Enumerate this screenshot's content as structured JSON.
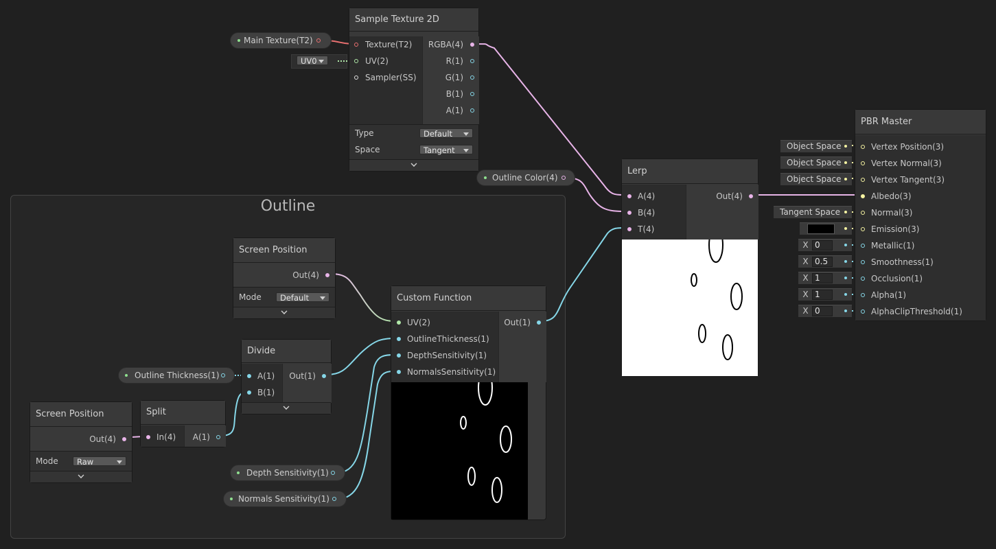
{
  "colors": {
    "bg": "#202020",
    "vec4_wire": "#e8b4e8",
    "vec1_wire": "#86d7e8",
    "vec2_wire": "#b0e8a8",
    "texture_wire": "#e87070",
    "vec3_wire": "#f6f4a2"
  },
  "group": {
    "title": "Outline"
  },
  "sample_texture": {
    "title": "Sample Texture 2D",
    "inputs": [
      "Texture(T2)",
      "UV(2)",
      "Sampler(SS)"
    ],
    "outputs": [
      "RGBA(4)",
      "R(1)",
      "G(1)",
      "B(1)",
      "A(1)"
    ],
    "type_label": "Type",
    "type_value": "Default",
    "space_label": "Space",
    "space_value": "Tangent",
    "uv_value": "UV0"
  },
  "main_texture_prop": {
    "label": "Main Texture(T2)"
  },
  "outline_color_prop": {
    "label": "Outline Color(4)"
  },
  "lerp": {
    "title": "Lerp",
    "inputs": [
      "A(4)",
      "B(4)",
      "T(4)"
    ],
    "output": "Out(4)"
  },
  "pbr_master": {
    "title": "PBR Master",
    "ports": [
      "Vertex Position(3)",
      "Vertex Normal(3)",
      "Vertex Tangent(3)",
      "Albedo(3)",
      "Normal(3)",
      "Emission(3)",
      "Metallic(1)",
      "Smoothness(1)",
      "Occlusion(1)",
      "Alpha(1)",
      "AlphaClipThreshold(1)"
    ],
    "slots": {
      "vertex_position": "Object Space",
      "vertex_normal": "Object Space",
      "vertex_tangent": "Object Space",
      "normal": "Tangent Space",
      "x_label": "X",
      "metallic": "0",
      "smoothness": "0.5",
      "occlusion": "1",
      "alpha": "1",
      "alpha_clip": "0"
    }
  },
  "screen_position_top": {
    "title": "Screen Position",
    "output": "Out(4)",
    "mode_label": "Mode",
    "mode_value": "Default"
  },
  "custom_function": {
    "title": "Custom Function",
    "inputs": [
      "UV(2)",
      "OutlineThickness(1)",
      "DepthSensitivity(1)",
      "NormalsSensitivity(1)"
    ],
    "output": "Out(1)"
  },
  "divide": {
    "title": "Divide",
    "inputs": [
      "A(1)",
      "B(1)"
    ],
    "output": "Out(1)"
  },
  "outline_thickness_prop": {
    "label": "Outline Thickness(1)"
  },
  "screen_position_bottom": {
    "title": "Screen Position",
    "output": "Out(4)",
    "mode_label": "Mode",
    "mode_value": "Raw"
  },
  "split": {
    "title": "Split",
    "input": "In(4)",
    "output": "A(1)"
  },
  "depth_sensitivity_prop": {
    "label": "Depth Sensitivity(1)"
  },
  "normals_sensitivity_prop": {
    "label": "Normals Sensitivity(1)"
  }
}
